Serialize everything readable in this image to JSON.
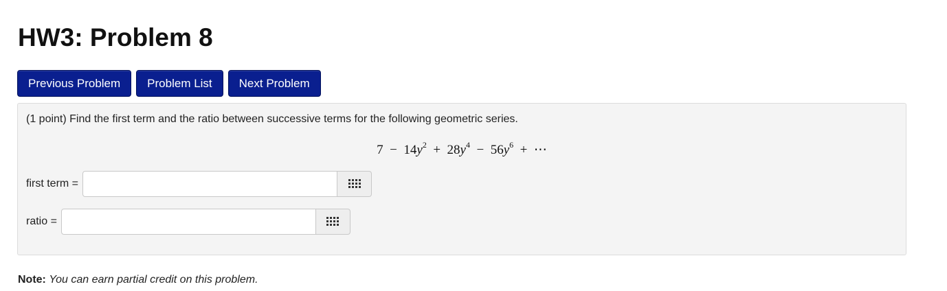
{
  "title": "HW3: Problem 8",
  "nav": {
    "previous": "Previous Problem",
    "list": "Problem List",
    "next": "Next Problem"
  },
  "problem": {
    "statement": "(1 point) Find the first term and the ratio between successive terms for the following geometric series.",
    "math": {
      "t1": "7",
      "op1": "−",
      "t2_coef": "14",
      "t2_exp": "2",
      "op2": "+",
      "t3_coef": "28",
      "t3_exp": "4",
      "op3": "−",
      "t4_coef": "56",
      "t4_exp": "6",
      "op4": "+",
      "ellipsis": "⋯",
      "var": "y"
    },
    "fields": [
      {
        "label": "first term =",
        "value": "",
        "palette_icon": "grid-icon"
      },
      {
        "label": "ratio =",
        "value": "",
        "palette_icon": "grid-icon"
      }
    ]
  },
  "note": {
    "label": "Note:",
    "text": "You can earn partial credit on this problem."
  }
}
